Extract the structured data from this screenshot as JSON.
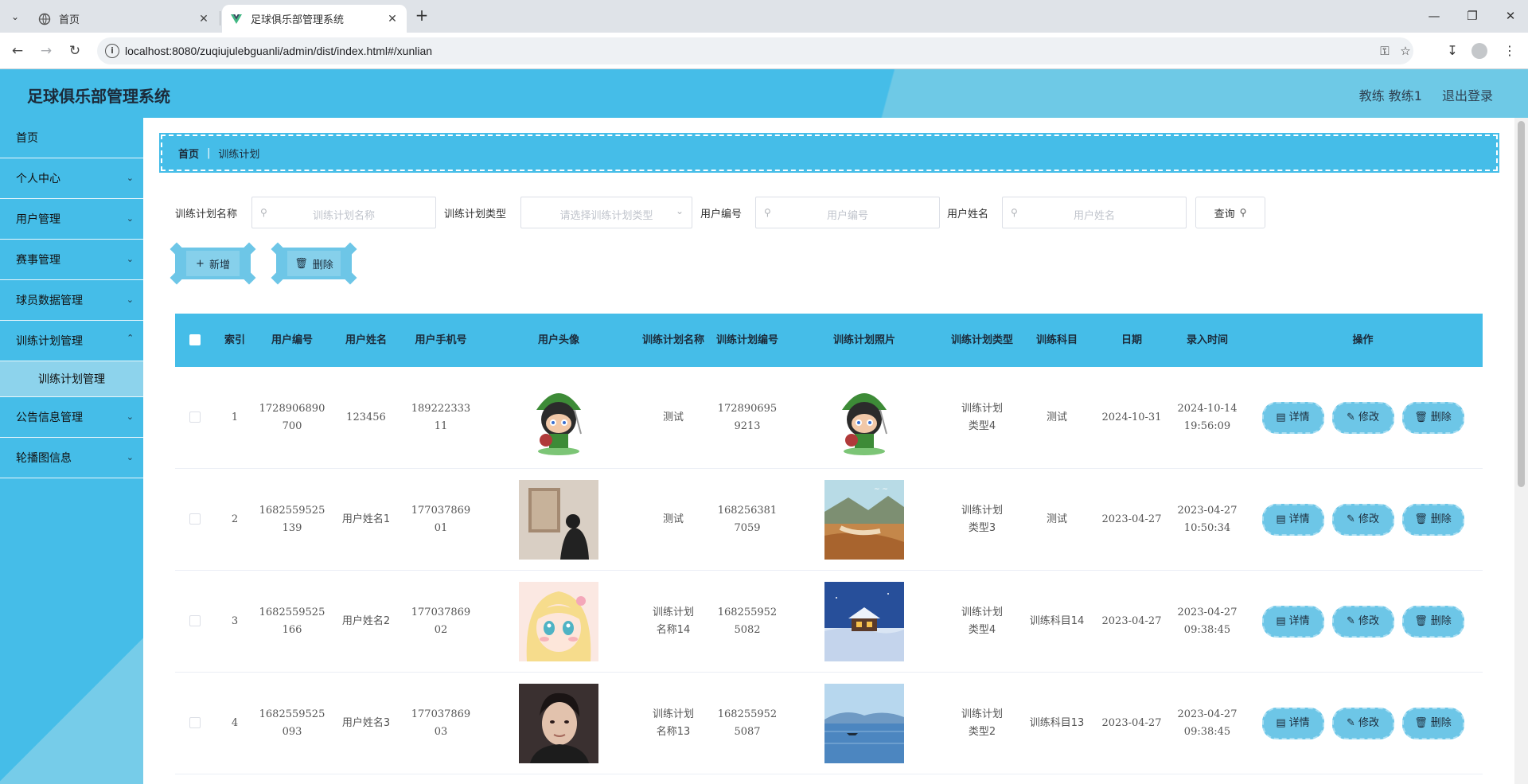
{
  "browser": {
    "tabs": [
      {
        "title": "首页",
        "active": false
      },
      {
        "title": "足球俱乐部管理系统",
        "active": true
      }
    ],
    "url": "localhost:8080/zuqiujulebguanli/admin/dist/index.html#/xunlian"
  },
  "header": {
    "title": "足球俱乐部管理系统",
    "user": "教练 教练1",
    "logout": "退出登录",
    "colors": {
      "primary": "#45bde8",
      "light": "#6ec9e6"
    }
  },
  "sidebar": {
    "items": [
      {
        "label": "首页",
        "expandable": false
      },
      {
        "label": "个人中心",
        "expandable": true
      },
      {
        "label": "用户管理",
        "expandable": true
      },
      {
        "label": "赛事管理",
        "expandable": true
      },
      {
        "label": "球员数据管理",
        "expandable": true
      },
      {
        "label": "训练计划管理",
        "expandable": true,
        "expanded": true
      },
      {
        "label": "公告信息管理",
        "expandable": true
      },
      {
        "label": "轮播图信息",
        "expandable": true
      }
    ],
    "sub_item": "训练计划管理"
  },
  "breadcrumb": {
    "home": "首页",
    "current": "训练计划"
  },
  "search": {
    "name_label": "训练计划名称",
    "name_placeholder": "训练计划名称",
    "type_label": "训练计划类型",
    "type_placeholder": "请选择训练计划类型",
    "uid_label": "用户编号",
    "uid_placeholder": "用户编号",
    "uname_label": "用户姓名",
    "uname_placeholder": "用户姓名",
    "query_label": "查询"
  },
  "actions": {
    "add_label": "新增",
    "delete_label": "删除"
  },
  "table": {
    "headers": [
      "索引",
      "用户编号",
      "用户姓名",
      "用户手机号",
      "用户头像",
      "训练计划名称",
      "训练计划编号",
      "训练计划照片",
      "训练计划类型",
      "训练科目",
      "日期",
      "录入时间",
      "操作"
    ],
    "op_labels": {
      "detail": "详情",
      "edit": "修改",
      "delete": "删除"
    },
    "rows": [
      {
        "index": "1",
        "uid": "1728906890700",
        "uname": "123456",
        "phone": "18922233311",
        "avatar": "octocat-avatar",
        "pname": "测试",
        "pno": "1728906959213",
        "photo": "octocat-photo",
        "ptype": "训练计划类型4",
        "subject": "测试",
        "date": "2024-10-31",
        "created": "2024-10-14 19:56:09"
      },
      {
        "index": "2",
        "uid": "1682559525139",
        "uname": "用户姓名1",
        "phone": "17703786901",
        "avatar": "gallery-person-avatar",
        "pname": "测试",
        "pno": "1682563817059",
        "photo": "autumn-landscape-photo",
        "ptype": "训练计划类型3",
        "subject": "测试",
        "date": "2023-04-27",
        "created": "2023-04-27 10:50:34"
      },
      {
        "index": "3",
        "uid": "1682559525166",
        "uname": "用户姓名2",
        "phone": "17703786902",
        "avatar": "anime-girl-avatar",
        "pname": "训练计划名称14",
        "pno": "1682559525082",
        "photo": "snow-cabin-photo",
        "ptype": "训练计划类型4",
        "subject": "训练科目14",
        "date": "2023-04-27",
        "created": "2023-04-27 09:38:45"
      },
      {
        "index": "4",
        "uid": "1682559525093",
        "uname": "用户姓名3",
        "phone": "17703786903",
        "avatar": "man-portrait-avatar",
        "pname": "训练计划名称13",
        "pno": "1682559525087",
        "photo": "lake-boat-photo",
        "ptype": "训练计划类型2",
        "subject": "训练科目13",
        "date": "2023-04-27",
        "created": "2023-04-27 09:38:45"
      }
    ]
  }
}
